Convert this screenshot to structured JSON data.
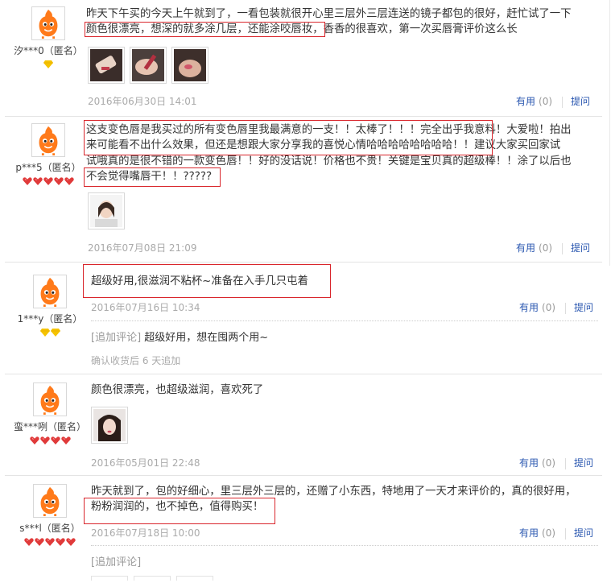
{
  "colors": {
    "highlight": "#d9262c",
    "link": "#2a57b0",
    "muted": "#aaaaaa",
    "gem_yellow": "#f5c300",
    "gem_red": "#e03a3a"
  },
  "reviews": [
    {
      "user": {
        "name": "汐***0（匿名）",
        "badge_icon": "yellow-diamond-icon",
        "badge_count": 1
      },
      "content_lines": [
        "昨天下午买的今天上午就到了，一看包装就很开心里三层外三层连送的镜子都包的很好，赶忙试了一下"
      ],
      "highlight_text": "颜色很漂亮，想深的就多涂几层，还能涂咬唇妆，",
      "content_after_highlight": "香香的很喜欢，第一次买唇膏评价这么长",
      "photos": [
        "photo-thumbnail",
        "photo-thumbnail",
        "photo-thumbnail"
      ],
      "date": "2016年06月30日 14:01",
      "useful_label": "有用",
      "useful_count": "(0)",
      "ask_label": "提问"
    },
    {
      "user": {
        "name": "p***5（匿名）",
        "badge_icon": "red-heart-icon",
        "badge_count": 5
      },
      "content_lines": [
        "这支变色唇是我买过的所有变色唇里我最满意的一支！！太棒了！！！完全出乎我意料！大爱啦！拍出",
        "来可能看不出什么效果，但还是想跟大家分享我的喜悦心情哈哈哈哈哈哈哈哈！！建议大家买回家试",
        "试哦真的是很不错的一款变色唇！！好的没话说！价格也不贵！关键是宝贝真的超级棒！！涂了以后也",
        "不会觉得嘴唇干！！?????"
      ],
      "photos": [
        "photo-thumbnail"
      ],
      "date": "2016年07月08日 21:09",
      "useful_label": "有用",
      "useful_count": "(0)",
      "ask_label": "提问"
    },
    {
      "user": {
        "name": "1***y（匿名）",
        "badge_icon": "yellow-diamond-icon",
        "badge_count": 2
      },
      "content_lines": [
        "超级好用,很滋润不粘杯~准备在入手几只屯着"
      ],
      "date": "2016年07月16日 10:34",
      "useful_label": "有用",
      "useful_count": "(0)",
      "ask_label": "提问",
      "append_tag": "[追加评论]",
      "append_text": "超级好用，想在囤两个用~",
      "confirm_text": "确认收货后 6 天追加"
    },
    {
      "user": {
        "name": "蛮***咧（匿名）",
        "badge_icon": "red-heart-icon",
        "badge_count": 4
      },
      "content_lines": [
        "颜色很漂亮，也超级滋润，喜欢死了"
      ],
      "photos": [
        "photo-thumbnail"
      ],
      "date": "2016年05月01日 22:48",
      "useful_label": "有用",
      "useful_count": "(0)",
      "ask_label": "提问"
    },
    {
      "user": {
        "name": "s***l（匿名）",
        "badge_icon": "red-heart-icon",
        "badge_count": 5
      },
      "content_lines": [
        "昨天就到了，包的好细心，里三层外三层的，还赠了小东西，特地用了一天才来评价的，真的很好用，",
        "粉粉润润的，也不掉色，值得购买！"
      ],
      "date": "2016年07月18日 10:00",
      "useful_label": "有用",
      "useful_count": "(0)",
      "ask_label": "提问",
      "append_tag": "[追加评论]"
    }
  ]
}
